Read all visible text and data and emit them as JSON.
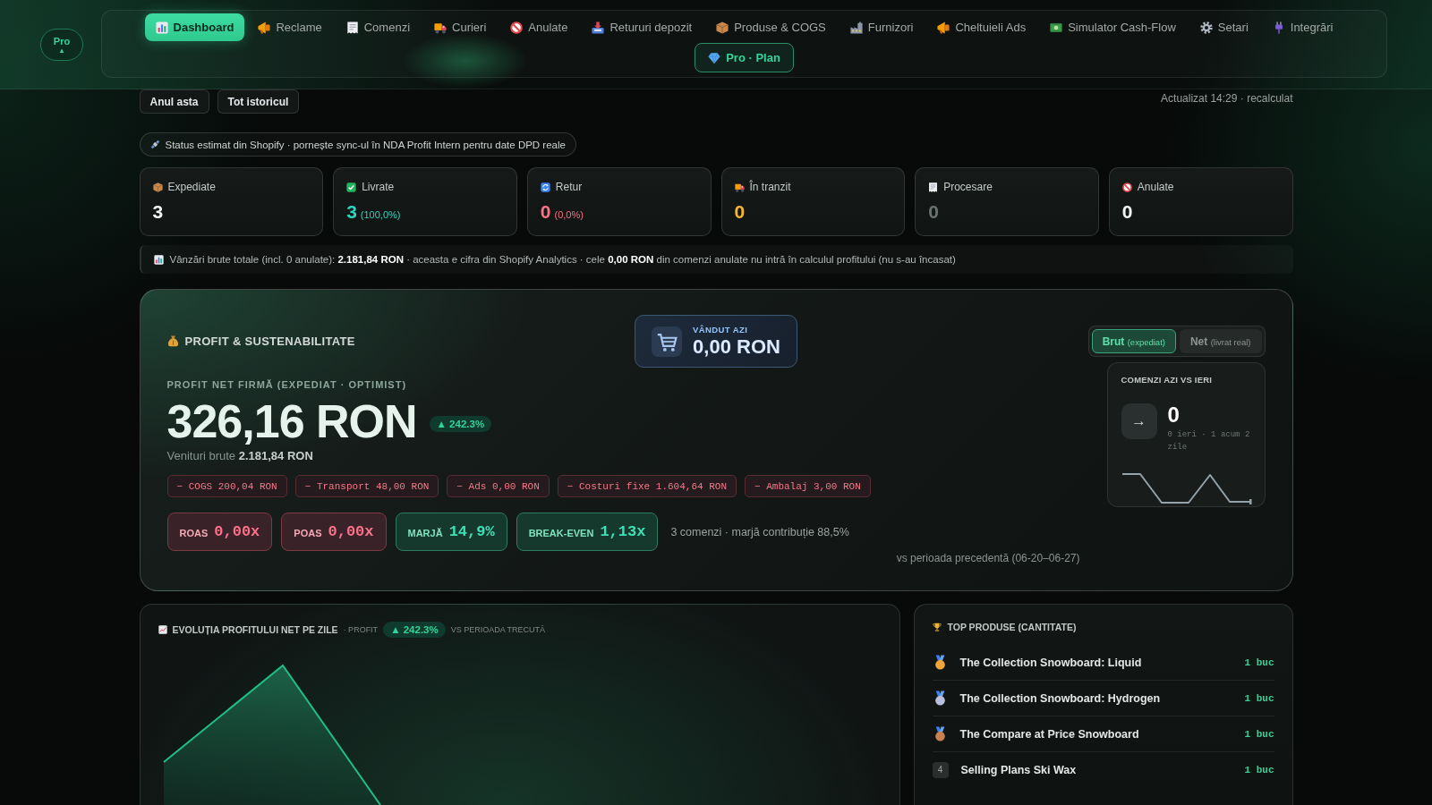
{
  "header": {
    "plan_badge": {
      "label": "Pro",
      "caret": "▴"
    },
    "nav": [
      {
        "label": "Dashboard",
        "selected": true
      },
      {
        "label": "Reclame",
        "selected": false
      },
      {
        "label": "Comenzi",
        "selected": false
      },
      {
        "label": "Curieri",
        "selected": false
      },
      {
        "label": "Anulate",
        "selected": false
      },
      {
        "label": "Retururi depozit",
        "selected": false
      },
      {
        "label": "Produse & COGS",
        "selected": false
      },
      {
        "label": "Furnizori",
        "selected": false
      },
      {
        "label": "Cheltuieli Ads",
        "selected": false
      },
      {
        "label": "Simulator Cash-Flow",
        "selected": false
      },
      {
        "label": "Setari",
        "selected": false
      },
      {
        "label": "Integrări",
        "selected": false
      }
    ],
    "plan_button": "Pro · Plan"
  },
  "toolbar": {
    "periods": [
      {
        "label": "Anul asta",
        "selected": false
      },
      {
        "label": "Tot istoricul",
        "selected": false
      }
    ],
    "updated": "Actualizat 14:29 · recalculat"
  },
  "status_notice": "Status estimat din Shopify · pornește sync-ul în NDA Profit Intern pentru date DPD reale",
  "kpis": [
    {
      "label": "Expediate",
      "value": "3",
      "color": "#f3f4f6"
    },
    {
      "label": "Livrate",
      "value": "3",
      "share": "(100,0%)",
      "color": "#2dd4bf"
    },
    {
      "label": "Retur",
      "value": "0",
      "share": "(0,0%)",
      "color": "#fb7185"
    },
    {
      "label": "În tranzit",
      "value": "0",
      "color": "#f5b731"
    },
    {
      "label": "Procesare",
      "value": "0",
      "color": "#6b7370"
    },
    {
      "label": "Anulate",
      "value": "0",
      "color": "#f3f4f6"
    }
  ],
  "sales_note": "Vânzări brute totale (incl. 0 anulate): **2.181,84 RON** · aceasta e cifra din Shopify Analytics · cele **0,00 RON** din comenzi anulate nu intră în calculul profitului (nu s-au încasat)",
  "profit": {
    "title": "PROFIT & SUSTENABILITATE",
    "sold_today": {
      "label": "VÂNDUT AZI",
      "value": "0,00 RON"
    },
    "modes": [
      {
        "label": "Brut",
        "hint": "(expediat)",
        "selected": true
      },
      {
        "label": "Net",
        "hint": "(livrat real)",
        "selected": false
      }
    ],
    "kicker": "PROFIT NET FIRMĂ (EXPEDIAT · OPTIMIST)",
    "amount": "326,16 RON",
    "change": "▲ 242.3%",
    "revenue": "Venituri brute **2.181,84 RON**",
    "deductions": [
      "− COGS 200,04 RON",
      "− Transport 48,00 RON",
      "− Ads 0,00 RON",
      "− Costuri fixe 1.604,64 RON",
      "− Ambalaj 3,00 RON"
    ],
    "metrics": [
      {
        "label": "ROAS",
        "value": "0,00x",
        "kind": "negative"
      },
      {
        "label": "POAS",
        "value": "0,00x",
        "kind": "negative"
      },
      {
        "label": "MARJĂ",
        "value": "14,9%",
        "kind": "positive"
      },
      {
        "label": "BREAK-EVEN",
        "value": "1,13x",
        "kind": "positive"
      }
    ],
    "metrics_note": "3 comenzi · marjă contribuție 88,5%",
    "comparison": "vs perioada precedentă (06-20–06-27)",
    "orders_today": {
      "title": "COMENZI AZI VS IERI",
      "trend": "→",
      "value": "0",
      "detail": "0 ieri · 1 acum 2 zile"
    }
  },
  "profit_chart": {
    "title": "EVOLUȚIA PROFITULUI NET PE ZILE",
    "subtitle": "· PROFIT",
    "change": "▲ 242.3%",
    "comparison": "VS PERIOADA TRECUTĂ"
  },
  "top_products": {
    "title": "TOP PRODUSE (CANTITATE)",
    "items": [
      {
        "kind": "medal",
        "color": "#f0a53a",
        "name": "The Collection Snowboard: Liquid",
        "quantity": "1 buc"
      },
      {
        "kind": "medal",
        "color": "#b9bfdc",
        "name": "The Collection Snowboard: Hydrogen",
        "quantity": "1 buc"
      },
      {
        "kind": "medal",
        "color": "#c9804f",
        "name": "The Compare at Price Snowboard",
        "quantity": "1 buc"
      },
      {
        "kind": "number",
        "rank": "4",
        "name": "Selling Plans Ski Wax",
        "quantity": "1 buc"
      }
    ]
  }
}
